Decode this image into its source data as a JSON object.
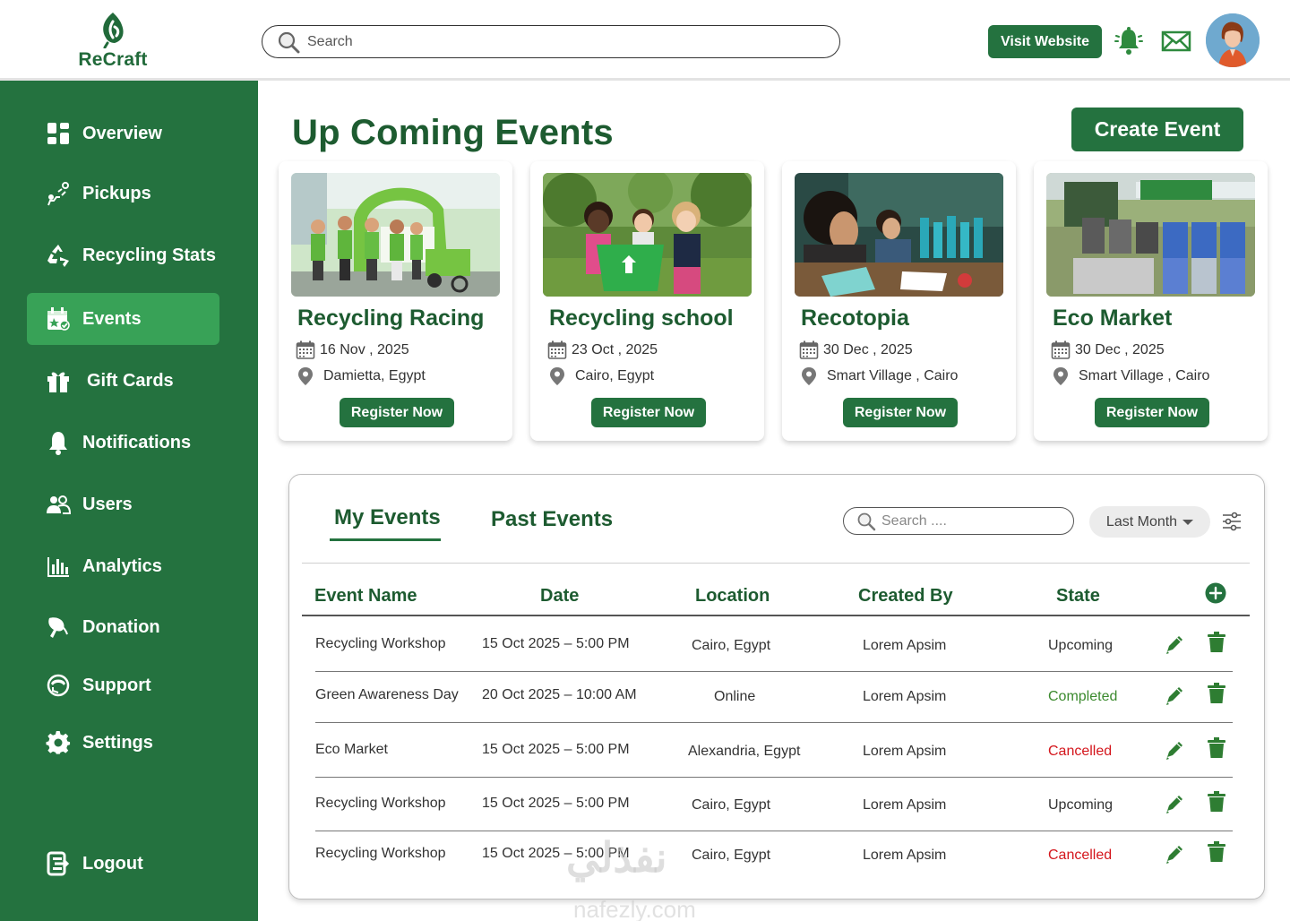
{
  "app": {
    "brand": "ReCraft"
  },
  "header": {
    "search_placeholder": "Search",
    "visit_label": "Visit Website"
  },
  "sidebar": {
    "items": [
      {
        "label": "Overview",
        "icon": "grid-icon"
      },
      {
        "label": "Pickups",
        "icon": "pickup-icon"
      },
      {
        "label": "Recycling Stats",
        "icon": "recycle-icon"
      },
      {
        "label": "Events",
        "icon": "calendar-icon",
        "active": true
      },
      {
        "label": "Gift Cards",
        "icon": "gift-icon"
      },
      {
        "label": "Notifications",
        "icon": "bell-icon"
      },
      {
        "label": "Users",
        "icon": "users-icon"
      },
      {
        "label": "Analytics",
        "icon": "chart-icon"
      },
      {
        "label": "Donation",
        "icon": "donation-icon"
      },
      {
        "label": "Support",
        "icon": "support-icon"
      },
      {
        "label": "Settings",
        "icon": "gear-icon"
      }
    ],
    "logout": "Logout"
  },
  "main": {
    "title": "Up Coming Events",
    "create_label": "Create Event",
    "cards": [
      {
        "title": "Recycling Racing",
        "date": "16 Nov , 2025",
        "location": "Damietta, Egypt",
        "register": "Register Now"
      },
      {
        "title": "Recycling school",
        "date": "23 Oct , 2025",
        "location": "Cairo, Egypt",
        "register": "Register Now"
      },
      {
        "title": "Recotopia",
        "date": "30 Dec , 2025",
        "location": "Smart Village , Cairo",
        "register": "Register Now"
      },
      {
        "title": "Eco Market",
        "date": "30 Dec , 2025",
        "location": "Smart Village , Cairo",
        "register": "Register Now"
      }
    ]
  },
  "panel": {
    "tabs": [
      "My Events",
      "Past Events"
    ],
    "search_placeholder": "Search ....",
    "filter_label": "Last Month",
    "columns": [
      "Event Name",
      "Date",
      "Location",
      "Created By",
      "State"
    ],
    "rows": [
      {
        "name": "Recycling Workshop",
        "date": "15 Oct 2025 – 5:00 PM",
        "location": "Cairo, Egypt",
        "created_by": "Lorem Apsim",
        "state": "Upcoming"
      },
      {
        "name": "Green Awareness Day",
        "date": "20 Oct 2025 – 10:00 AM",
        "location": "Online",
        "created_by": "Lorem Apsim",
        "state": "Completed"
      },
      {
        "name": "Eco Market",
        "date": "15 Oct 2025 – 5:00 PM",
        "location": "Alexandria, Egypt",
        "created_by": "Lorem Apsim",
        "state": "Cancelled"
      },
      {
        "name": "Recycling Workshop",
        "date": "15 Oct 2025 – 5:00 PM",
        "location": "Cairo, Egypt",
        "created_by": "Lorem Apsim",
        "state": "Upcoming"
      },
      {
        "name": "Recycling Workshop",
        "date": "15 Oct 2025 – 5:00 PM",
        "location": "Cairo, Egypt",
        "created_by": "Lorem Apsim",
        "state": "Cancelled"
      }
    ]
  },
  "watermark": {
    "text": "نفذلي",
    "sub": "nafezly.com"
  },
  "colors": {
    "brand_green": "#24723f",
    "active_green": "#38a257",
    "title_green": "#1d5b30",
    "completed": "#3b8a2e",
    "cancelled": "#d4161c"
  }
}
